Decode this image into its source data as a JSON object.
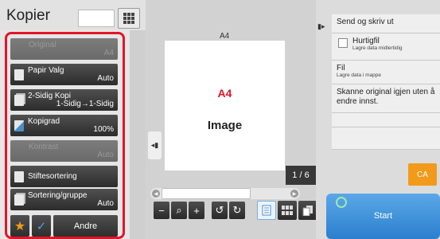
{
  "header": {
    "title": "Kopier",
    "copies_value": ""
  },
  "functions": [
    {
      "label": "Original",
      "value": "A4",
      "enabled": false,
      "icon": "none"
    },
    {
      "label": "Papir Valg",
      "value": "Auto",
      "enabled": true,
      "icon": "paper-icon"
    },
    {
      "label": "2-Sidig Kopi",
      "value": "1-Sidig→1-Sidig",
      "enabled": true,
      "icon": "duplex-icon"
    },
    {
      "label": "Kopigrad",
      "value": "100%",
      "enabled": true,
      "icon": "zoom-ratio-icon"
    },
    {
      "label": "Kontrast",
      "value": "Auto",
      "enabled": false,
      "icon": "none"
    },
    {
      "label": "Stiftesortering",
      "value": "",
      "enabled": true,
      "icon": "staple-sort-icon"
    },
    {
      "label": "Sortering/gruppe",
      "value": "Auto",
      "enabled": true,
      "icon": "sort-group-icon"
    }
  ],
  "bottom": {
    "star": "★",
    "check": "✓",
    "other_label": "Andre"
  },
  "preview": {
    "paper_size": "A4",
    "page_a4": "A4",
    "page_image": "Image",
    "page_counter": "1 / 6",
    "side_arrow": "◂▮",
    "scroll_left": "◀",
    "scroll_right": "▶"
  },
  "tools": {
    "zoom_out": "−",
    "zoom": "⌕",
    "zoom_in": "+",
    "rotate_left": "↺",
    "rotate_right": "↻"
  },
  "right": {
    "collapse": "▮▸",
    "send_print": "Send og skriv ut",
    "quick_file": "Hurtigfil",
    "quick_file_sub": "Lagre data midlertidig",
    "file": "Fil",
    "file_sub": "Lagre data i mappe",
    "rescan": "Skanne original igjen uten å endre innst."
  },
  "actions": {
    "ca": "CA",
    "start": "Start"
  },
  "colors": {
    "accent_red": "#e0152a",
    "ca_orange": "#f29a1a",
    "start_blue": "#3a8fda"
  }
}
